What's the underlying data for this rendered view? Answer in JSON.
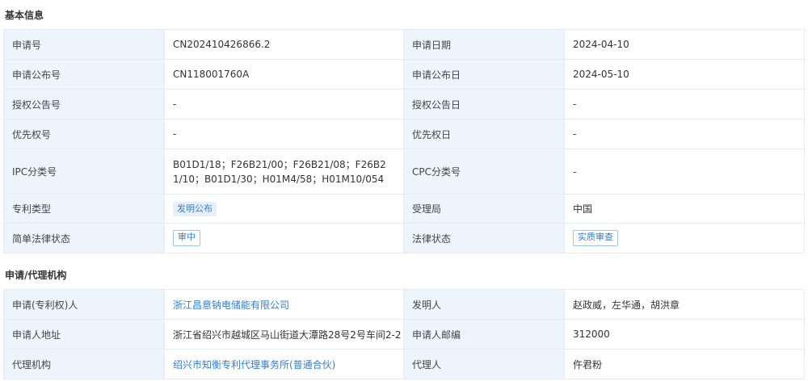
{
  "basic": {
    "title": "基本信息",
    "rows": [
      {
        "l1": "申请号",
        "v1": "CN202410426866.2",
        "l2": "申请日期",
        "v2": "2024-04-10"
      },
      {
        "l1": "申请公布号",
        "v1": "CN118001760A",
        "l2": "申请公布日",
        "v2": "2024-05-10"
      },
      {
        "l1": "授权公告号",
        "v1": "-",
        "l2": "授权公告日",
        "v2": "-"
      },
      {
        "l1": "优先权号",
        "v1": "-",
        "l2": "优先权日",
        "v2": "-"
      },
      {
        "l1": "IPC分类号",
        "v1": "B01D1/18；F26B21/00；F26B21/08；F26B21/10；B01D1/30；H01M4/58；H01M10/054",
        "l2": "CPC分类号",
        "v2": "-"
      },
      {
        "l1": "专利类型",
        "v1": "发明公布",
        "l2": "受理局",
        "v2": "中国"
      },
      {
        "l1": "简单法律状态",
        "v1": "审中",
        "l2": "法律状态",
        "v2": "实质审查"
      }
    ]
  },
  "agency": {
    "title": "申请/代理机构",
    "rows": [
      {
        "l1": "申请(专利权)人",
        "v1": "浙江昌意钠电储能有限公司",
        "l2": "发明人",
        "v2": "赵政威，左华通，胡洪章"
      },
      {
        "l1": "申请人地址",
        "v1": "浙江省绍兴市越城区马山街道大潭路28号2号车间2-2",
        "l2": "申请人邮编",
        "v2": "312000"
      },
      {
        "l1": "代理机构",
        "v1": "绍兴市知衡专利代理事务所(普通合伙)",
        "l2": "代理人",
        "v2": "仵君粉"
      }
    ]
  },
  "colors": {
    "label_bg": "#eef4fb",
    "border": "#e3ebf3",
    "link": "#2f7de1"
  }
}
